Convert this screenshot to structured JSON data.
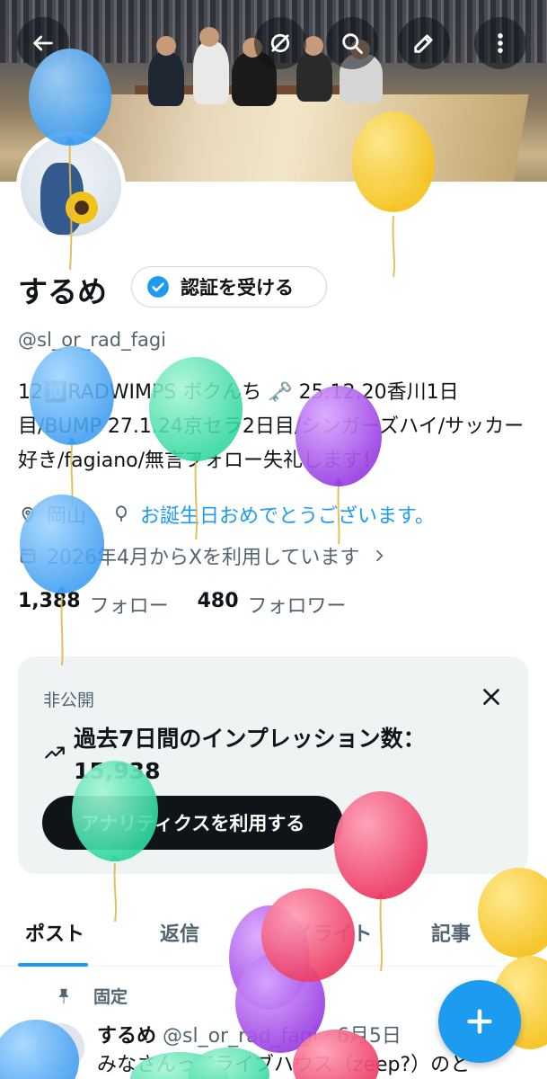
{
  "profile": {
    "name": "するめ",
    "verify_label": "認証を受ける",
    "handle": "@sl_or_rad_fagi",
    "bio": "12🔟RADWIMPS ボクんち 🗝️ 25.12.20香川1日目/BUMP 27.1.24京セラ2日目/シンガーズハイ/サッカー好き/fagiano/無言フォロー失礼します！",
    "location": "岡山",
    "birthday_link": "お誕生日おめでとうございます。",
    "joined": "2026年4月からXを利用しています",
    "following_count": "1,388",
    "following_label": "フォロー",
    "followers_count": "480",
    "followers_label": "フォロワー"
  },
  "card": {
    "private_label": "非公開",
    "title": "過去7日間のインプレッション数：15,938",
    "button_label": "アナリティクスを利用する"
  },
  "tabs": [
    {
      "label": "ポスト"
    },
    {
      "label": "返信"
    },
    {
      "label": "ハイライト"
    },
    {
      "label": "記事"
    }
  ],
  "post": {
    "pinned_label": "固定",
    "author": "するめ",
    "meta": "@sl_or_rad_fagi · 6月5日",
    "text": "みなさんってライブハウス（zeep?）のと"
  },
  "icons": {
    "back": "arrow-left-icon",
    "mute": "slash-circle-icon",
    "search": "search-icon",
    "edit": "pencil-icon",
    "more": "more-vertical-icon",
    "compose": "plus-icon"
  },
  "colors": {
    "accent": "#1d9bf0",
    "text": "#0f1419",
    "muted": "#536471",
    "balloon_blue": "#4aa8f5",
    "balloon_yellow": "#f8cd2c",
    "balloon_green": "#3fe0a6",
    "balloon_purple": "#a64ce8",
    "balloon_red": "#f0476e"
  }
}
